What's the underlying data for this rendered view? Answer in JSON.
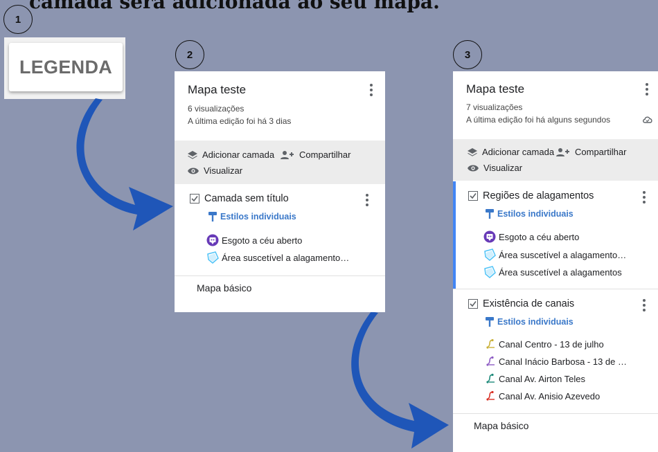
{
  "title": "camada será adicionada ao seu mapa.",
  "steps": [
    "1",
    "2",
    "3"
  ],
  "legend_button": "LEGENDA",
  "panel2": {
    "map_title": "Mapa teste",
    "views": "6 visualizações",
    "edited": "A última edição foi há 3 dias",
    "add_layer": "Adicionar camada",
    "share": "Compartilhar",
    "preview": "Visualizar",
    "layer": {
      "title": "Camada sem título",
      "style": "Estilos individuais",
      "items": [
        "Esgoto a céu aberto",
        "Área suscetível a alagamento…"
      ]
    },
    "basemap": "Mapa básico"
  },
  "panel3": {
    "map_title": "Mapa teste",
    "views": "7 visualizações",
    "edited": "A última edição foi há alguns segundos",
    "add_layer": "Adicionar camada",
    "share": "Compartilhar",
    "preview": "Visualizar",
    "layer1": {
      "title": "Regiões de alagamentos",
      "style": "Estilos individuais",
      "items": [
        "Esgoto a céu aberto",
        "Área suscetível a alagamento…",
        "Área suscetível a alagamentos"
      ]
    },
    "layer2": {
      "title": "Existência de canais",
      "style": "Estilos individuais",
      "items": [
        {
          "label": "Canal Centro - 13 de julho",
          "color": "#c9b037"
        },
        {
          "label": "Canal Inácio Barbosa  - 13 de …",
          "color": "#8e5cc4"
        },
        {
          "label": "Canal  Av. Airton Teles",
          "color": "#1e8a7a"
        },
        {
          "label": "Canal Av. Anisio Azevedo",
          "color": "#d93025"
        }
      ]
    },
    "basemap": "Mapa básico"
  },
  "colors": {
    "background": "#8c95b0",
    "arrow": "#1f56b8",
    "link": "#3a78c9",
    "marker_purple": "#673ab7",
    "polygon": "#4fc3f7",
    "selected_bar": "#4285f4"
  }
}
